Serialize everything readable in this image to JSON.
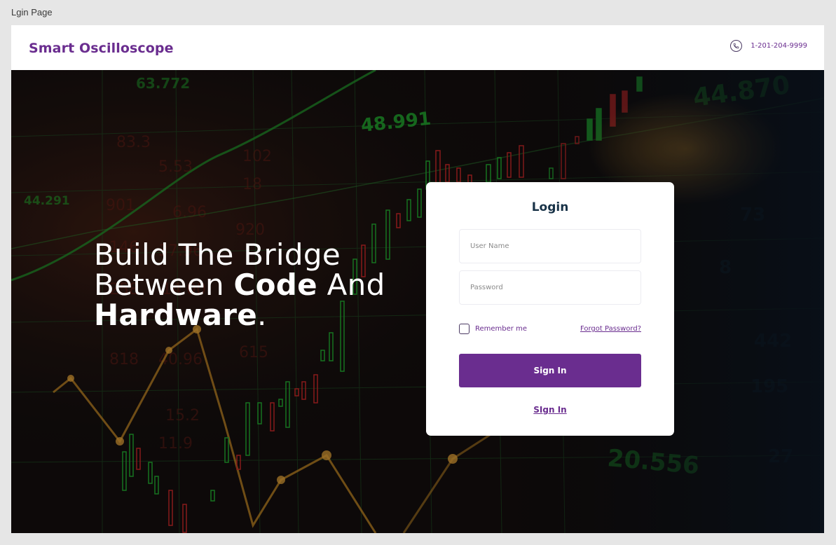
{
  "frame": {
    "label": "Lgin Page"
  },
  "header": {
    "brand": "Smart Oscilloscope",
    "phone_icon": "phone-icon",
    "phone_number": "1-201-204-9999"
  },
  "hero": {
    "headline_part1": "Build The Bridge",
    "headline_part2": "Between ",
    "headline_bold1": "Code",
    "headline_part3": " And",
    "headline_bold2": "Hardware",
    "headline_part4": ".",
    "background_numbers": [
      "63.772",
      "48.991",
      "44.291",
      "44.870",
      "20.556"
    ]
  },
  "login": {
    "title": "Login",
    "username_placeholder": "User Name",
    "password_placeholder": "Password",
    "remember_label": "Remember me",
    "forgot_label": "Forgot Password?",
    "signin_button": "Sign In",
    "signin_link": "SIgn In"
  },
  "colors": {
    "brand": "#6a2d8f",
    "title": "#183247",
    "hero_bg": "#0b0c10"
  }
}
